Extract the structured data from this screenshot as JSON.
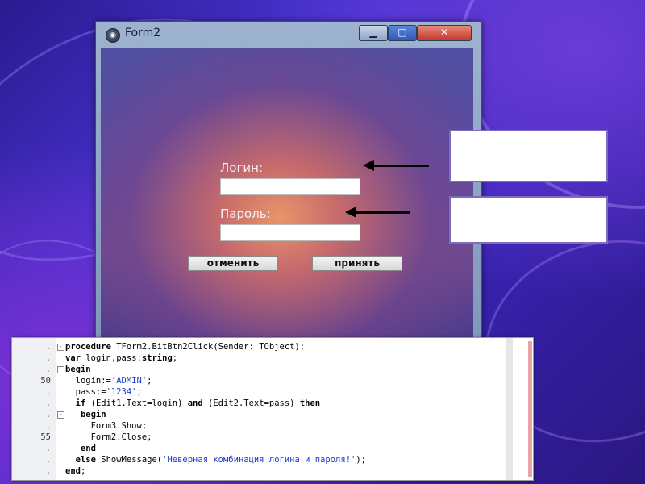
{
  "window": {
    "title": "Form2",
    "minimize_glyph": "▁",
    "maximize_glyph": "□",
    "close_glyph": "✕"
  },
  "form": {
    "login_label": "Логин:",
    "password_label": "Пароль:",
    "login_value": "",
    "password_value": "",
    "cancel_button": "отменить",
    "accept_button": "принять"
  },
  "icons": {
    "app": "app-icon",
    "arrow": "arrow-left-icon"
  },
  "code": {
    "lines": [
      {
        "ln": ".",
        "fold": "-",
        "parts": [
          {
            "t": "procedure ",
            "c": "kw"
          },
          {
            "t": "TForm2.BitBtn2Click(Sender: TObject);"
          }
        ]
      },
      {
        "ln": ".",
        "fold": "",
        "parts": [
          {
            "t": "var ",
            "c": "kw"
          },
          {
            "t": "login,pass:"
          },
          {
            "t": "string",
            "c": "kw"
          },
          {
            "t": ";"
          }
        ]
      },
      {
        "ln": ".",
        "fold": "-",
        "parts": [
          {
            "t": "begin",
            "c": "kw"
          }
        ]
      },
      {
        "ln": "50",
        "fold": "",
        "parts": [
          {
            "t": "  login:="
          },
          {
            "t": "'ADMIN'",
            "c": "str"
          },
          {
            "t": ";"
          }
        ]
      },
      {
        "ln": ".",
        "fold": "",
        "parts": [
          {
            "t": "  pass:="
          },
          {
            "t": "'1234'",
            "c": "str"
          },
          {
            "t": ";"
          }
        ]
      },
      {
        "ln": ".",
        "fold": "",
        "parts": [
          {
            "t": "  "
          },
          {
            "t": "if ",
            "c": "kw"
          },
          {
            "t": "(Edit1.Text=login) "
          },
          {
            "t": "and ",
            "c": "kw"
          },
          {
            "t": "(Edit2.Text=pass) "
          },
          {
            "t": "then",
            "c": "kw"
          }
        ]
      },
      {
        "ln": ".",
        "fold": "-",
        "parts": [
          {
            "t": "   "
          },
          {
            "t": "begin",
            "c": "kw"
          }
        ]
      },
      {
        "ln": ".",
        "fold": "",
        "parts": [
          {
            "t": "     Form3.Show;"
          }
        ]
      },
      {
        "ln": "55",
        "fold": "",
        "parts": [
          {
            "t": "     Form2.Close;"
          }
        ]
      },
      {
        "ln": ".",
        "fold": "",
        "parts": [
          {
            "t": "   "
          },
          {
            "t": "end",
            "c": "kw"
          }
        ]
      },
      {
        "ln": ".",
        "fold": "",
        "parts": [
          {
            "t": "  "
          },
          {
            "t": "else ",
            "c": "kw"
          },
          {
            "t": "ShowMessage("
          },
          {
            "t": "'Неверная комбинация логина и пароля!'",
            "c": "str"
          },
          {
            "t": ");"
          }
        ]
      },
      {
        "ln": ".",
        "fold": "",
        "parts": [
          {
            "t": "end",
            "c": "kw"
          },
          {
            "t": ";"
          }
        ]
      }
    ]
  }
}
